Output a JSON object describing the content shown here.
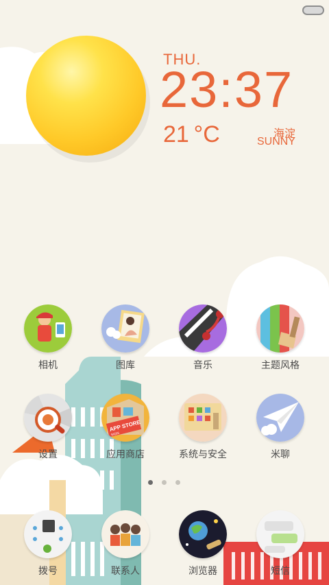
{
  "weather": {
    "day": "THU.",
    "time": "23:37",
    "temperature": "21 °C",
    "location": "海淀",
    "condition": "SUNNY"
  },
  "apps": [
    {
      "label": "相机",
      "icon": "camera-icon"
    },
    {
      "label": "图库",
      "icon": "gallery-icon"
    },
    {
      "label": "音乐",
      "icon": "music-icon"
    },
    {
      "label": "主题风格",
      "icon": "theme-icon"
    },
    {
      "label": "设置",
      "icon": "settings-icon"
    },
    {
      "label": "应用商店",
      "icon": "app-store-icon"
    },
    {
      "label": "系统与安全",
      "icon": "security-icon"
    },
    {
      "label": "米聊",
      "icon": "miliao-icon"
    },
    {
      "label": "拨号",
      "icon": "dialer-icon"
    },
    {
      "label": "联系人",
      "icon": "contacts-icon"
    },
    {
      "label": "浏览器",
      "icon": "browser-icon"
    },
    {
      "label": "短信",
      "icon": "messages-icon"
    }
  ],
  "icon_texts": {
    "app_store_sign": "APP STORE",
    "app_store_sign_small": "SIGN"
  },
  "page_indicator": {
    "count": 3,
    "active": 1
  },
  "colors": {
    "accent": "#e8673a",
    "background": "#f6f3ea"
  }
}
